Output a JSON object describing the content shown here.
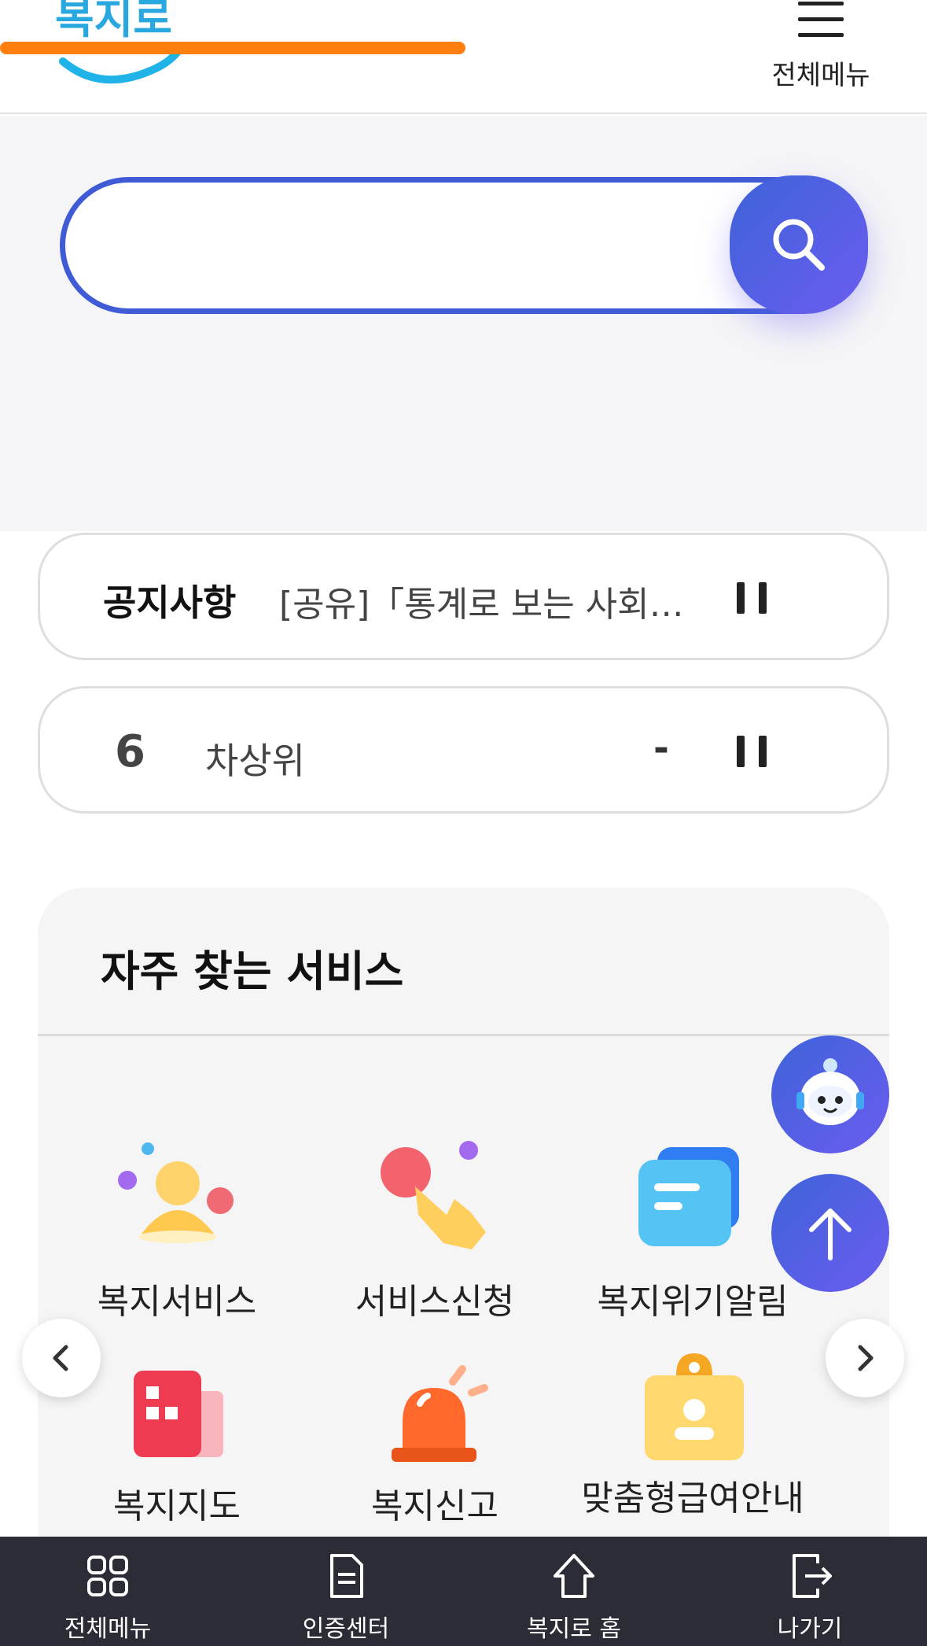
{
  "header": {
    "logo_text": "복지로",
    "menu_label": "전체메뉴"
  },
  "search": {
    "value": "",
    "placeholder": ""
  },
  "notice": {
    "title": "공지사항",
    "text": "[공유]「통계로 보는 사회…"
  },
  "ranking": {
    "rank": "6",
    "keyword": "차상위",
    "change": "-"
  },
  "services": {
    "title": "자주 찾는 서비스",
    "items": [
      {
        "label": "복지서비스"
      },
      {
        "label": "서비스신청"
      },
      {
        "label": "복지위기알림"
      },
      {
        "label": "복지지도"
      },
      {
        "label": "복지신고"
      },
      {
        "label": "맞춤형급여안내"
      }
    ]
  },
  "bottom_nav": {
    "items": [
      {
        "label": "전체메뉴",
        "icon": "grid-icon"
      },
      {
        "label": "인증센터",
        "icon": "document-icon"
      },
      {
        "label": "복지로 홈",
        "icon": "home-icon"
      },
      {
        "label": "나가기",
        "icon": "exit-icon"
      }
    ]
  },
  "colors": {
    "accent": "#3f5bd6",
    "accent_gradient_end": "#6b5cf0",
    "annotation_line": "#ff7f0e",
    "nav_bg": "#2b2c35"
  }
}
